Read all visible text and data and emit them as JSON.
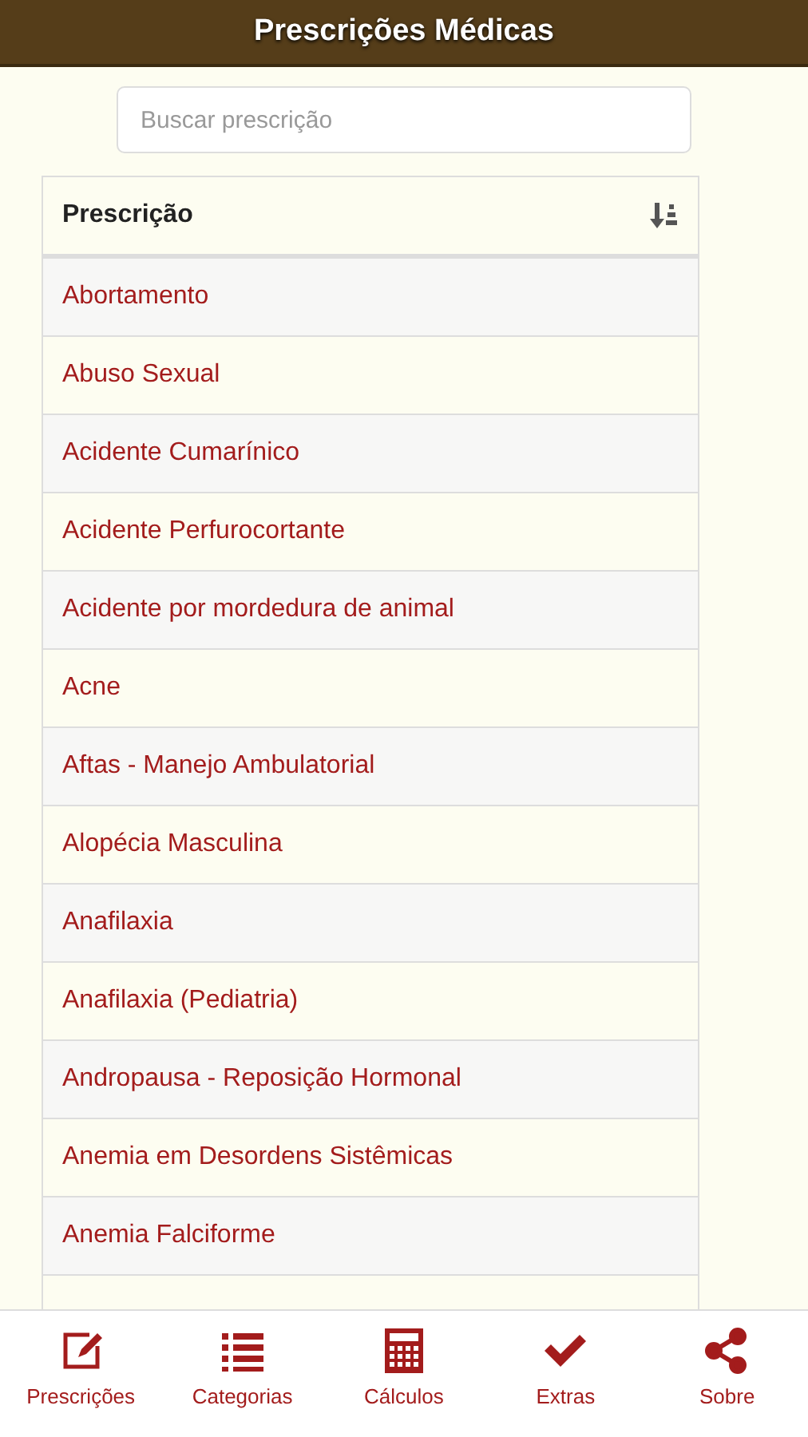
{
  "app_bar": {
    "title": "Prescrições Médicas"
  },
  "search": {
    "placeholder": "Buscar prescrição"
  },
  "table": {
    "column": "Prescrição",
    "rows": [
      "Abortamento",
      "Abuso Sexual",
      "Acidente Cumarínico",
      "Acidente Perfurocortante",
      "Acidente por mordedura de animal",
      "Acne",
      "Aftas - Manejo Ambulatorial",
      "Alopécia Masculina",
      "Anafilaxia",
      "Anafilaxia (Pediatria)",
      "Andropausa - Reposição Hormonal",
      "Anemia em Desordens Sistêmicas",
      "Anemia Falciforme"
    ]
  },
  "bottom_nav": [
    {
      "label": "Prescrições"
    },
    {
      "label": "Categorias"
    },
    {
      "label": "Cálculos"
    },
    {
      "label": "Extras"
    },
    {
      "label": "Sobre"
    }
  ]
}
